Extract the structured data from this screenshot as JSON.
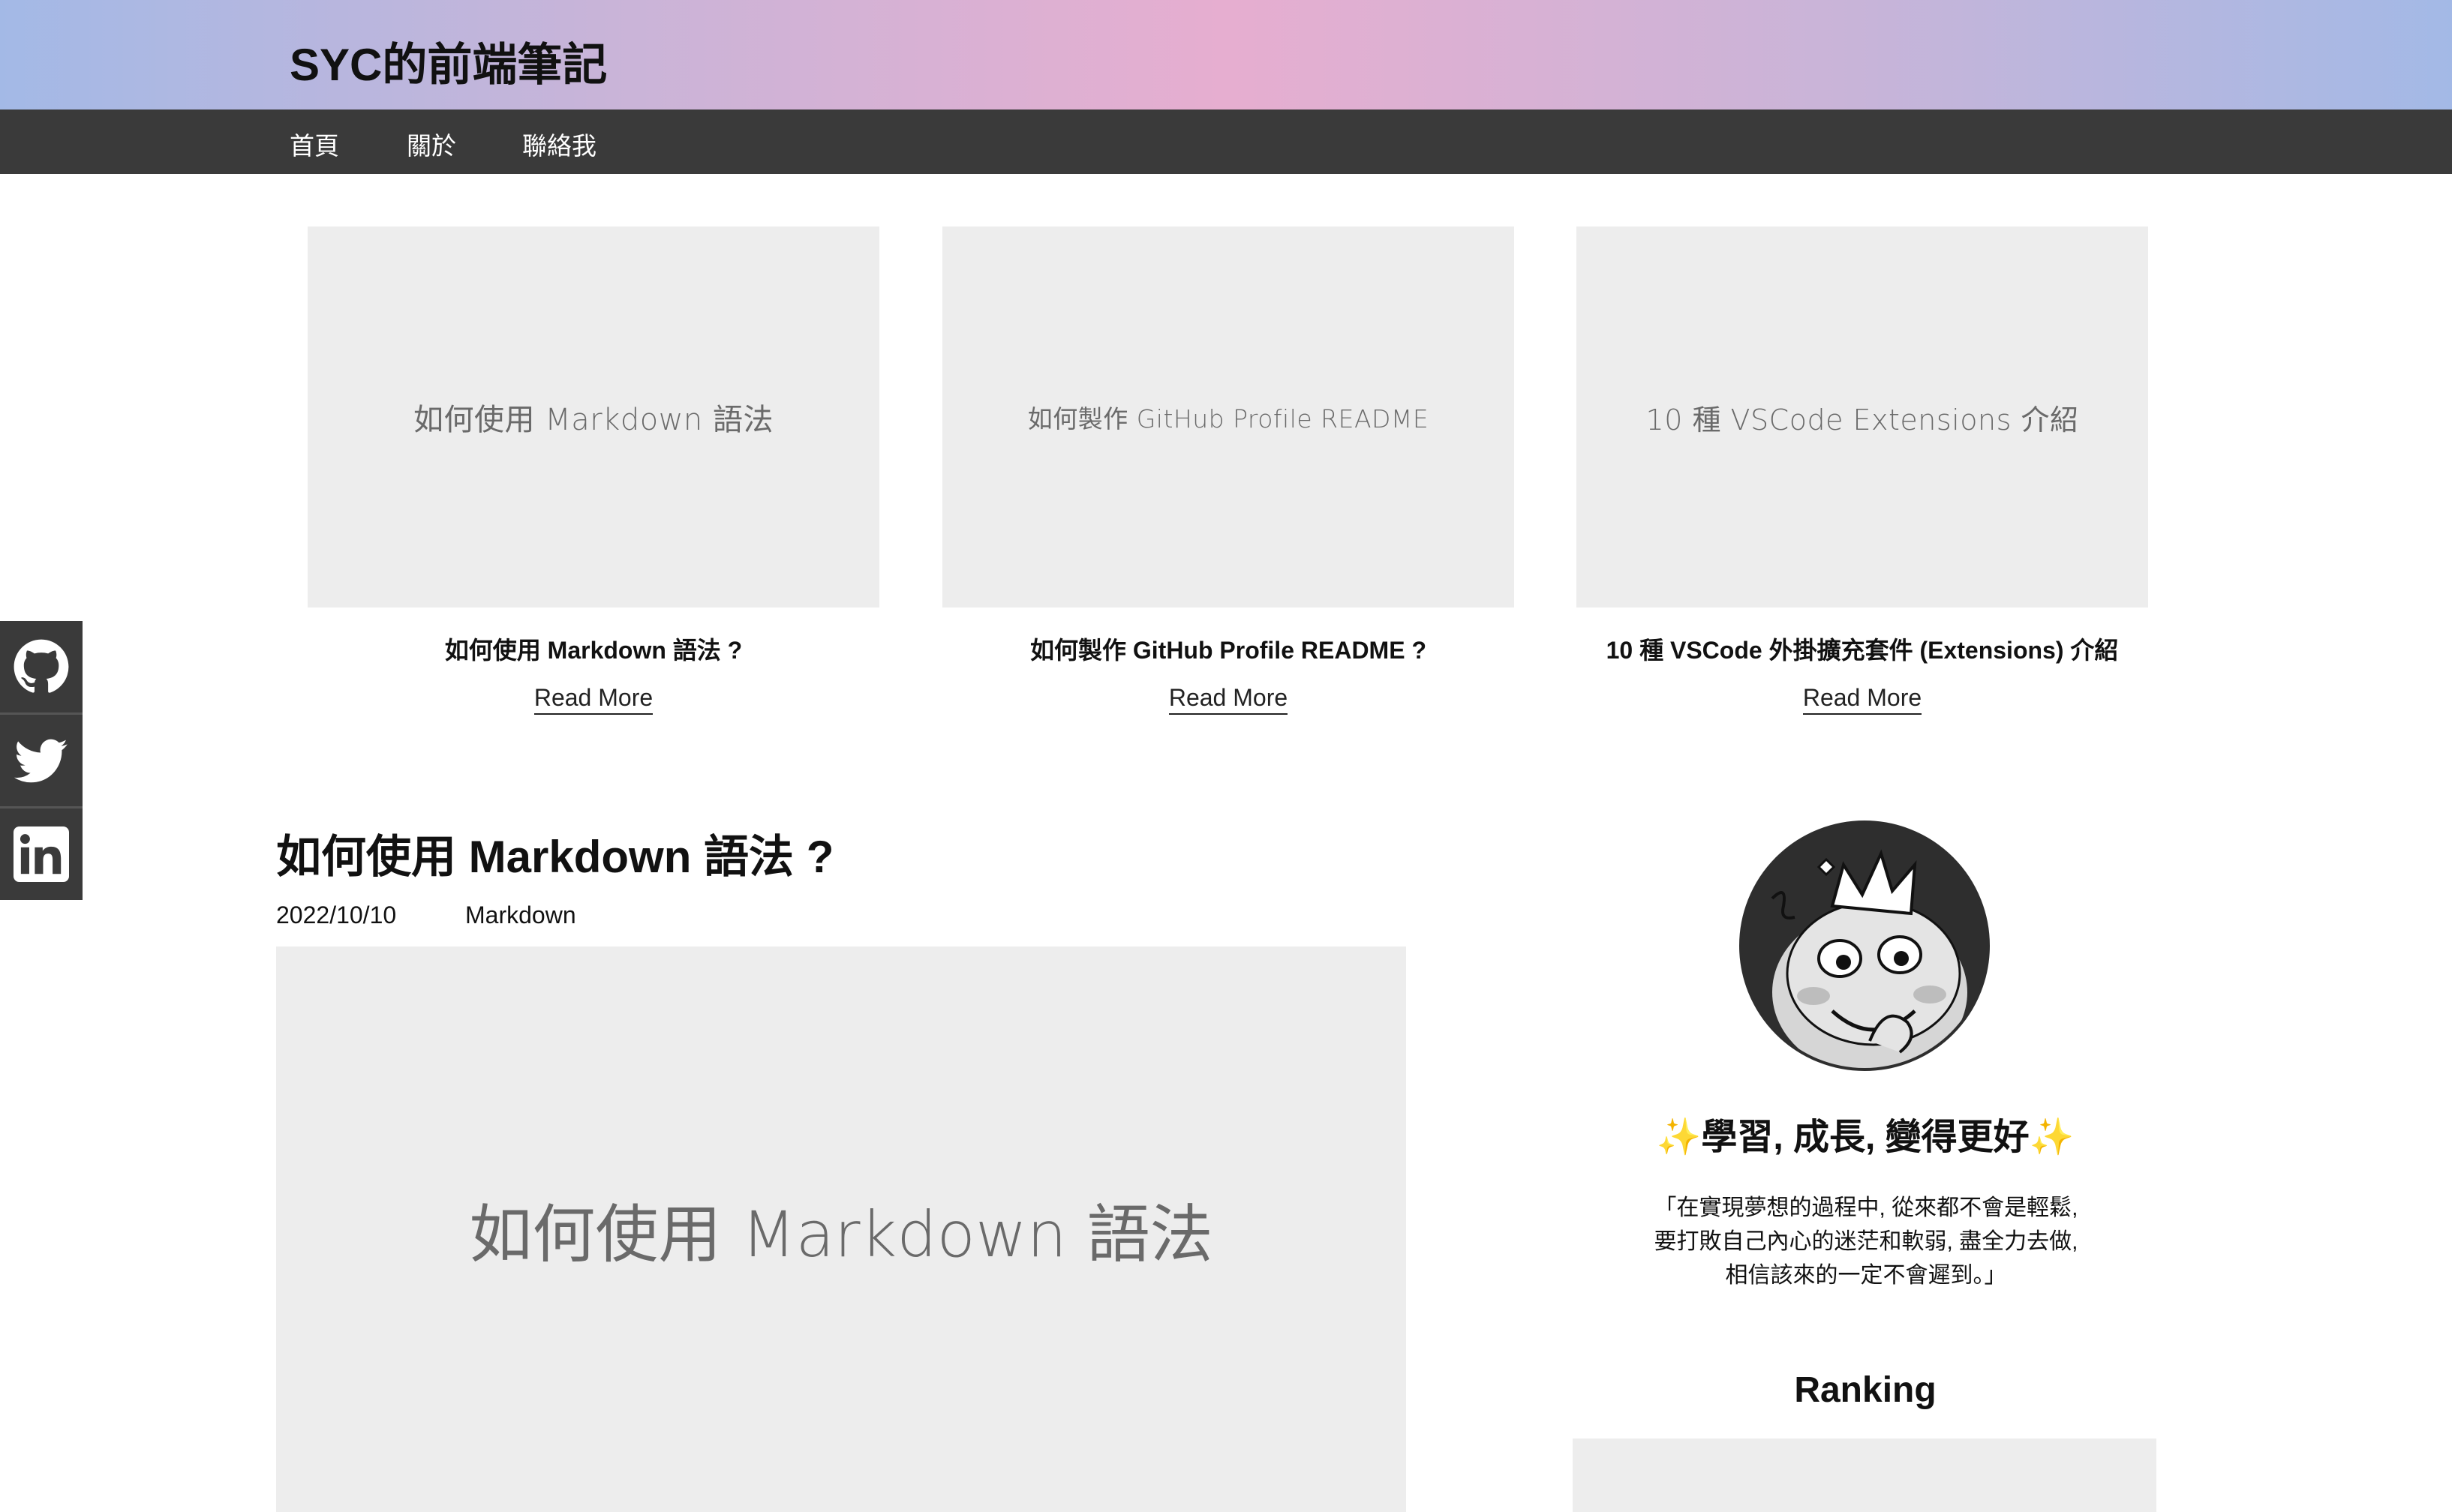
{
  "site": {
    "title": "SYC的前端筆記"
  },
  "nav": {
    "items": [
      "首頁",
      "關於",
      "聯絡我"
    ]
  },
  "social": {
    "icons": [
      "github-icon",
      "twitter-icon",
      "linkedin-icon"
    ]
  },
  "featured": [
    {
      "thumb_text": "如何使用 Markdown 語法",
      "title": "如何使用 Markdown 語法 ?",
      "more": "Read More"
    },
    {
      "thumb_text": "如何製作 GitHub Profile README",
      "title": "如何製作 GitHub Profile README ?",
      "more": "Read More"
    },
    {
      "thumb_text": "10 種 VSCode Extensions 介紹",
      "title": "10 種 VSCode 外掛擴充套件 (Extensions) 介紹",
      "more": "Read More"
    }
  ],
  "post": {
    "title": "如何使用 Markdown 語法 ?",
    "date": "2022/10/10",
    "tag": "Markdown",
    "image_text": "如何使用 Markdown 語法"
  },
  "sidebar": {
    "motto": "學習, 成長, 變得更好",
    "sparkle": "✨",
    "quote": "「在實現夢想的過程中, 從來都不會是輕鬆, 要打敗自己內心的迷茫和軟弱, 盡全力去做, 相信該來的一定不會遲到。」",
    "ranking_title": "Ranking"
  },
  "colors": {
    "header_gradient": [
      "#a3b9e6",
      "#e6aed0",
      "#a3b9e6"
    ],
    "navbar": "#3a3a3a",
    "placeholder": "#ededed",
    "sparkle": "#f2c531"
  }
}
